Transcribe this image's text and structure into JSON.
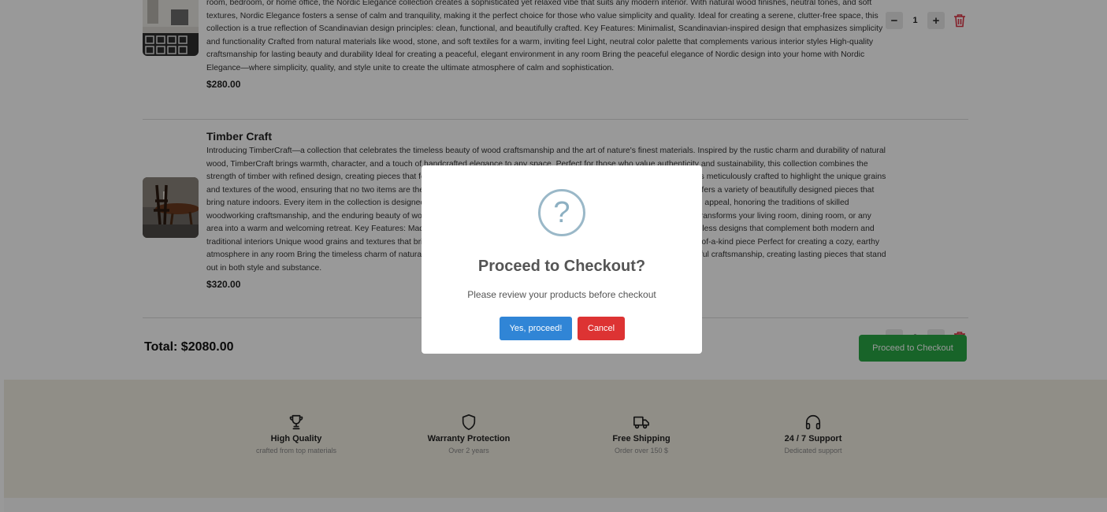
{
  "cart": {
    "items": [
      {
        "name": "",
        "description": "room, bedroom, or home office, the Nordic Elegance collection creates a sophisticated yet relaxed vibe that suits any modern interior. With natural wood finishes, neutral tones, and soft textures, Nordic Elegance fosters a sense of calm and tranquility, making it the perfect choice for those who value simplicity and quality. Ideal for creating a serene, clutter-free space, this collection is a true reflection of Scandinavian design principles: clean, functional, and beautifully crafted. Key Features: Minimalist, Scandinavian-inspired design that emphasizes simplicity and functionality Crafted from natural materials like wood, stone, and soft textiles for a warm, inviting feel Light, neutral color palette that complements various interior styles High-quality craftsmanship for lasting beauty and durability Ideal for creating a peaceful, elegant environment in any room Bring the peaceful elegance of Nordic design into your home with Nordic Elegance—where simplicity, quality, and style unite to create the ultimate atmosphere of calm and sophistication.",
        "price": "$280.00",
        "quantity": "1",
        "minus": "−",
        "plus": "+"
      },
      {
        "name": "Timber Craft",
        "description": "Introducing TimberCraft—a collection that celebrates the timeless beauty of wood craftsmanship and the art of nature's finest materials. Inspired by the rustic charm and durability of natural wood, TimberCraft brings warmth, character, and a touch of handcrafted elegance to any space. Perfect for those who value authenticity and sustainability, this collection combines the strength of timber with refined design, creating pieces that feel both timeless and modern alike. Each piece in the TimberCraft collection is meticulously crafted to highlight the unique grains and textures of the wood, ensuring that no two items are the same. Whether you're looking for furniture, decor, or accents, TimberCraft offers a variety of beautifully designed pieces that bring nature indoors. Every item in the collection is designed to stand the test of time, with materials chosen for their durability and lasting appeal, honoring the traditions of skilled woodworking craftsmanship, and the enduring beauty of wood. From striking tables and chairs to decorative accessories, this collection transforms your living room, dining room, or any area into a warm and welcoming retreat. Key Features: Made from high-quality, sustainable timber for lasting strength and durability Timeless designs that complement both modern and traditional interiors Unique wood grains and textures that bring natural beauty to your home Handcrafted with attention to detail for a one-of-a-kind piece Perfect for creating a cozy, earthy atmosphere in any room Bring the timeless charm of natural wood into your home with TimberCraft, where nature's beauty meets masterful craftsmanship, creating lasting pieces that stand out in both style and substance.",
        "price": "$320.00",
        "quantity": "3",
        "minus": "−",
        "plus": "+"
      }
    ],
    "total": "Total: $2080.00",
    "checkout_label": "Proceed to Checkout"
  },
  "features": [
    {
      "title": "High Quality",
      "subtitle": "crafted from top materials",
      "icon": "trophy-icon"
    },
    {
      "title": "Warranty Protection",
      "subtitle": "Over 2 years",
      "icon": "shield-icon"
    },
    {
      "title": "Free Shipping",
      "subtitle": "Order over 150 $",
      "icon": "truck-icon"
    },
    {
      "title": "24 / 7 Support",
      "subtitle": "Dedicated support",
      "icon": "headphones-icon"
    }
  ],
  "modal": {
    "icon": "?",
    "title": "Proceed to Checkout?",
    "text": "Please review your products before checkout",
    "confirm_label": "Yes, proceed!",
    "cancel_label": "Cancel"
  },
  "colors": {
    "checkout_green": "#28a745",
    "confirm_blue": "#3085d6",
    "cancel_red": "#dd3333",
    "trash_red": "#dc3545",
    "footer_beige": "#f1ede2"
  }
}
